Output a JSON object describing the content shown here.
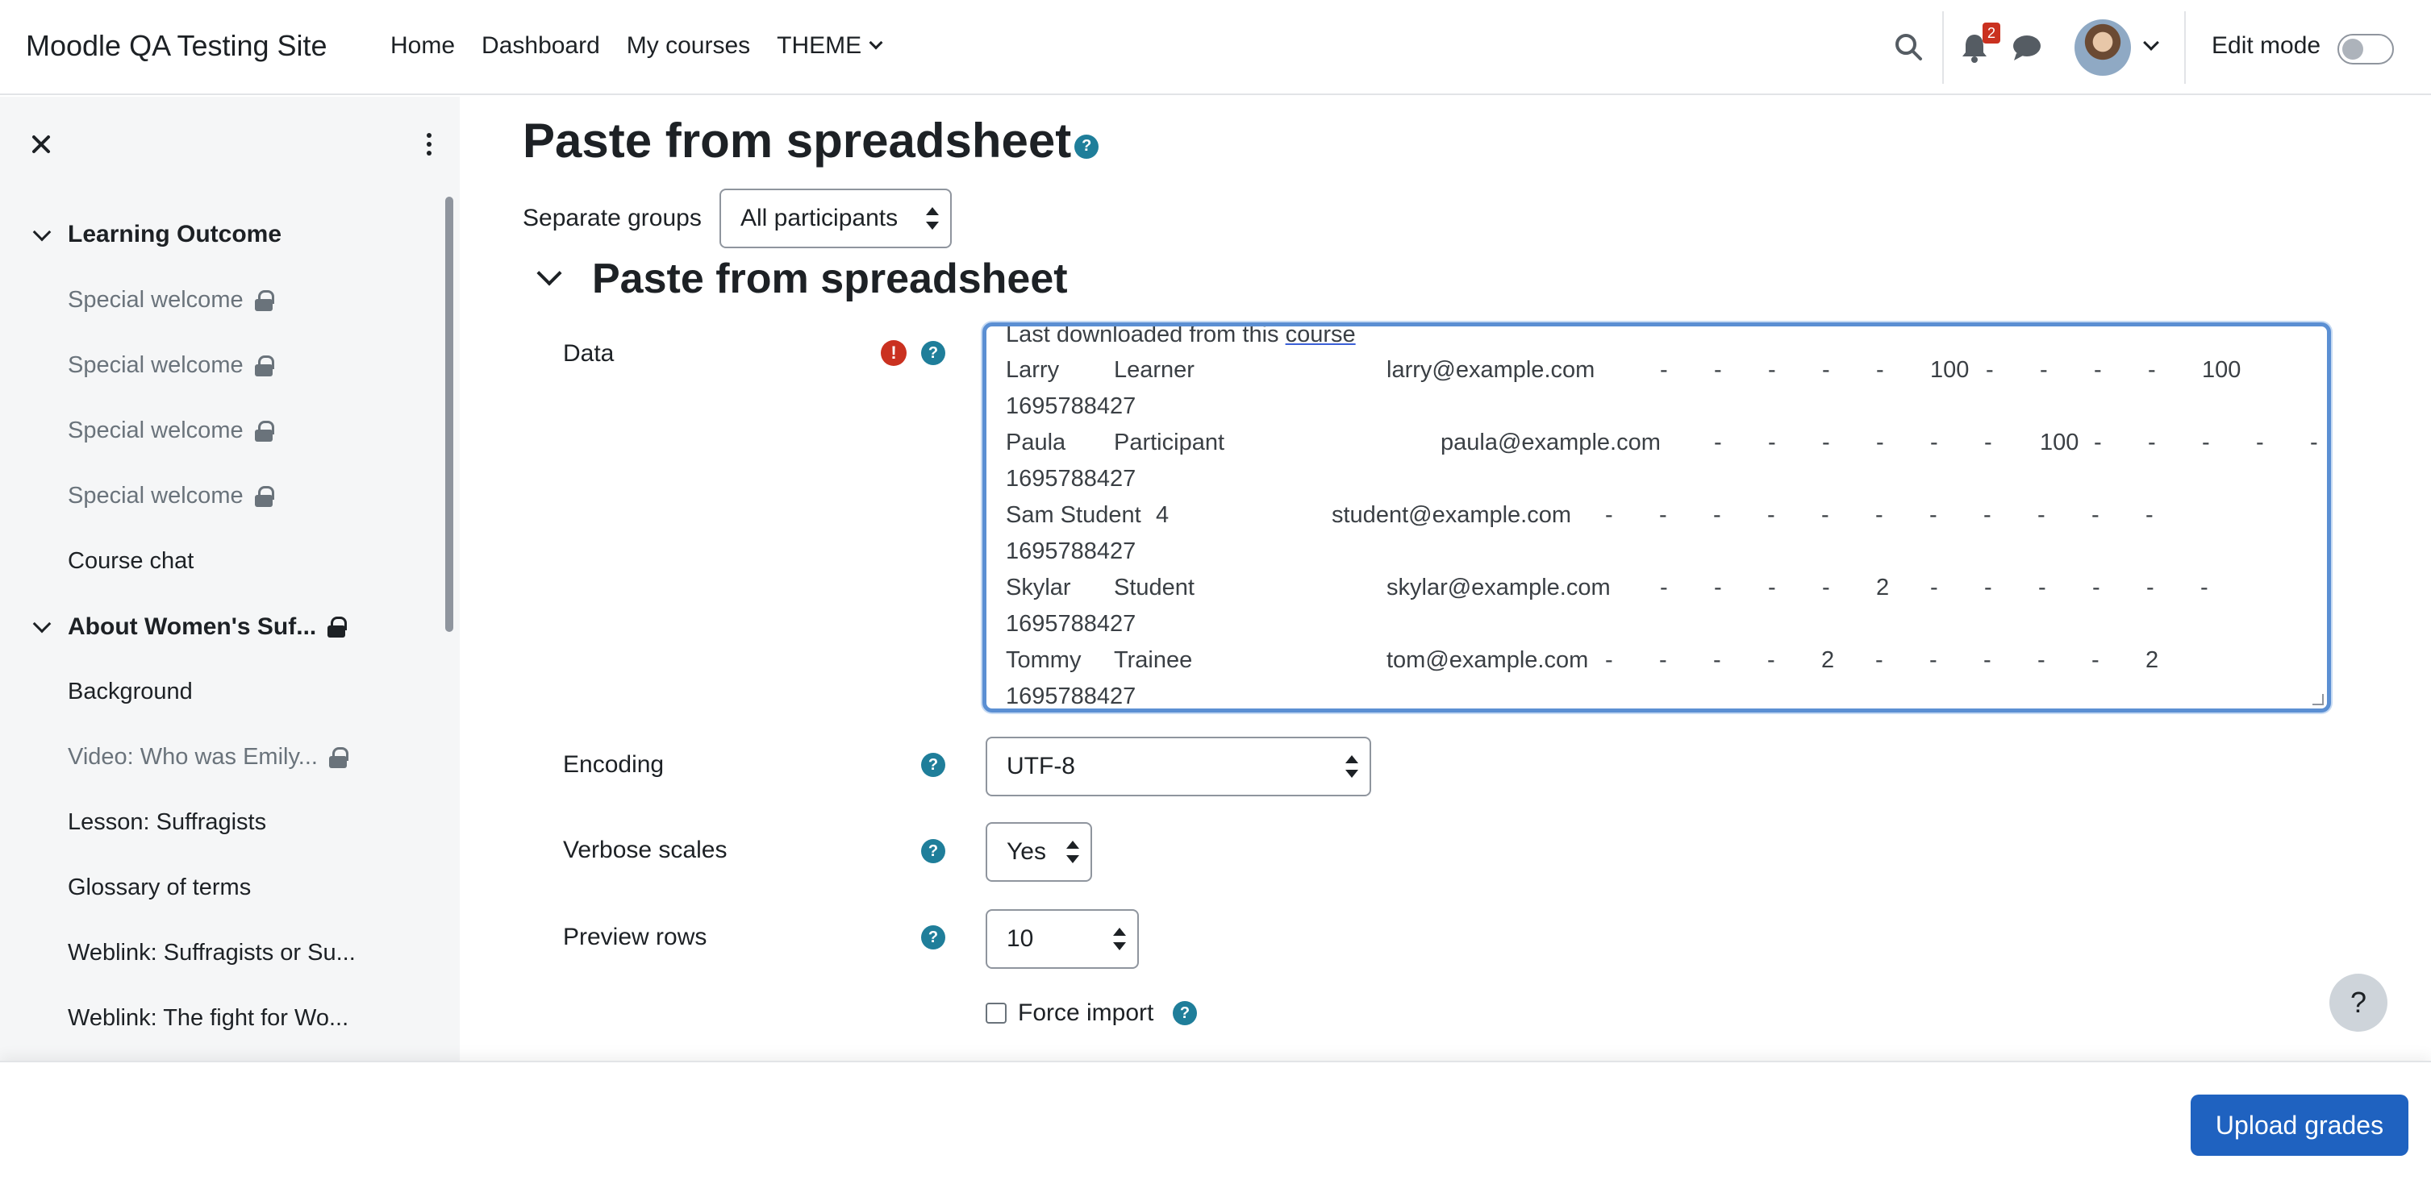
{
  "navbar": {
    "site_name": "Moodle QA Testing Site",
    "links": [
      "Home",
      "Dashboard",
      "My courses",
      "THEME"
    ],
    "notification_count": "2",
    "edit_mode_label": "Edit mode",
    "edit_mode_on": false
  },
  "sidebar": {
    "sections": [
      {
        "label": "Learning Outcome",
        "locked": false
      },
      {
        "label": "About Women's Suf...",
        "locked": true
      }
    ],
    "items": [
      {
        "label": "Special welcome",
        "locked": true,
        "dim": true
      },
      {
        "label": "Special welcome",
        "locked": true,
        "dim": true
      },
      {
        "label": "Special welcome",
        "locked": true,
        "dim": true
      },
      {
        "label": "Special welcome",
        "locked": true,
        "dim": true
      },
      {
        "label": "Course chat",
        "locked": false,
        "dim": false
      },
      {
        "label": "Background",
        "locked": false,
        "dim": false
      },
      {
        "label": "Video: Who was Emily...",
        "locked": true,
        "dim": true
      },
      {
        "label": "Lesson: Suffragists",
        "locked": false,
        "dim": false
      },
      {
        "label": "Glossary of terms",
        "locked": false,
        "dim": false
      },
      {
        "label": "Weblink: Suffragists or Su...",
        "locked": false,
        "dim": false
      },
      {
        "label": "Weblink: The fight for Wo...",
        "locked": false,
        "dim": false
      }
    ]
  },
  "main": {
    "page_title": "Paste from spreadsheet",
    "groups_label": "Separate groups",
    "groups_value": "All participants",
    "section_title": "Paste from spreadsheet",
    "data_label": "Data",
    "data_text": {
      "first_line_prefix": "Last downloaded from this ",
      "first_line_link": "course",
      "rows": [
        {
          "first": "Larry",
          "last": "Learner",
          "email": "larry@example.com",
          "cells": [
            "-",
            "-",
            "-",
            "-",
            "-",
            "100",
            "-",
            "-",
            "-",
            "-",
            "100"
          ],
          "timestamp": "1695788427"
        },
        {
          "first": "Paula",
          "last": "Participant",
          "email": "paula@example.com",
          "cells": [
            "-",
            "-",
            "-",
            "-",
            "-",
            "-",
            "100",
            "-",
            "-",
            "-",
            "-",
            "-"
          ],
          "timestamp": "1695788427"
        },
        {
          "first": "Sam Student",
          "last": "4",
          "email": "student@example.com",
          "cells": [
            "-",
            "-",
            "-",
            "-",
            "-",
            "-",
            "-",
            "-",
            "-",
            "-",
            "-"
          ],
          "timestamp": "1695788427"
        },
        {
          "first": "Skylar",
          "last": "Student",
          "email": "skylar@example.com",
          "cells": [
            "-",
            "-",
            "-",
            "-",
            "2",
            "-",
            "-",
            "-",
            "-",
            "-",
            "-"
          ],
          "timestamp": "1695788427"
        },
        {
          "first": "Tommy",
          "last": "Trainee",
          "email": "tom@example.com",
          "cells": [
            "-",
            "-",
            "-",
            "-",
            "2",
            "-",
            "-",
            "-",
            "-",
            "-",
            "2"
          ],
          "timestamp": "1695788427"
        }
      ]
    },
    "encoding_label": "Encoding",
    "encoding_value": "UTF-8",
    "verbose_label": "Verbose scales",
    "verbose_value": "Yes",
    "preview_label": "Preview rows",
    "preview_value": "10",
    "force_import_label": "Force import",
    "force_import_checked": false
  },
  "footer": {
    "upload_label": "Upload grades",
    "help_fab": "?"
  },
  "colors": {
    "primary": "#1f62c0",
    "help_icon": "#1f7e9a",
    "error_icon": "#ca3120",
    "focus_border": "#5b8fd3"
  }
}
